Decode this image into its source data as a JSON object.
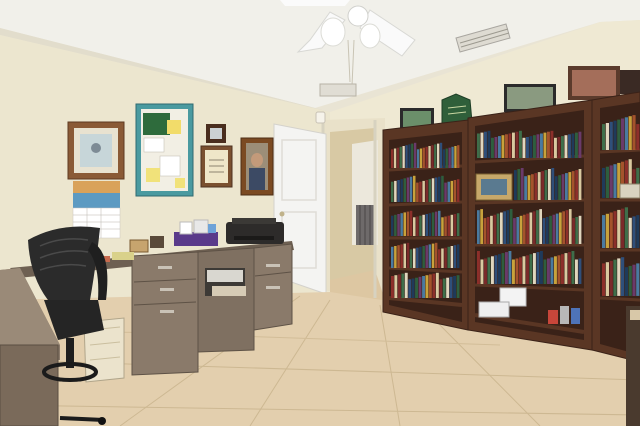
{
  "scene": {
    "colors": {
      "wall": "#ece6cf",
      "wall_right": "#efe9d3",
      "ceiling": "#f1f0ea",
      "floor": "#e3cfae",
      "floor_line": "#cdb892",
      "shelf_wood": "#5a3624",
      "shelf_dark": "#3a2218",
      "desk": "#8a7a6a",
      "desk_dark": "#6e6052",
      "door": "#f4f4f2",
      "chair": "#2b2b2b"
    }
  }
}
